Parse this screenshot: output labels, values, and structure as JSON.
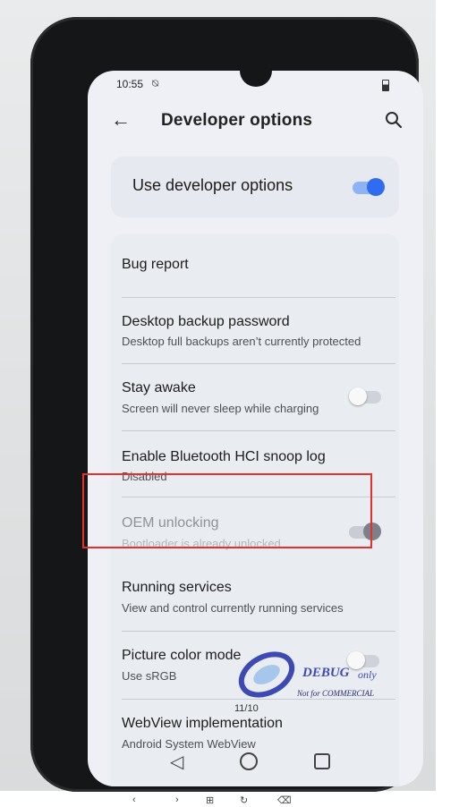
{
  "status_bar": {
    "time": "10:55"
  },
  "app_bar": {
    "title": "Developer options",
    "back_icon": "arrow-left-icon",
    "search_icon": "search-icon"
  },
  "master_switch": {
    "label": "Use developer options",
    "enabled": true
  },
  "settings": [
    {
      "title": "Bug report",
      "subtitle": ""
    },
    {
      "title": "Desktop backup password",
      "subtitle": "Desktop full backups aren’t currently protected"
    },
    {
      "title": "Stay awake",
      "subtitle": "Screen will never sleep while charging",
      "toggle": "off"
    },
    {
      "title": "Enable Bluetooth HCI snoop log",
      "subtitle": "Disabled"
    },
    {
      "title": "OEM unlocking",
      "subtitle": "Bootloader is already unlocked",
      "toggle": "on-disabled",
      "highlighted": true
    },
    {
      "title": "Running services",
      "subtitle": "View and control currently running services"
    },
    {
      "title": "Picture color mode",
      "subtitle": "Use sRGB",
      "toggle": "off"
    },
    {
      "title": "WebView implementation",
      "subtitle": "Android System WebView"
    }
  ],
  "watermark": {
    "brand": "DEBUG",
    "only": "only",
    "note": "Not for COMMERCIAL",
    "version": "11/10"
  },
  "colors": {
    "accent": "#2f6cf0",
    "highlight_border": "#e8302a",
    "screen_bg": "#eef0f5"
  }
}
